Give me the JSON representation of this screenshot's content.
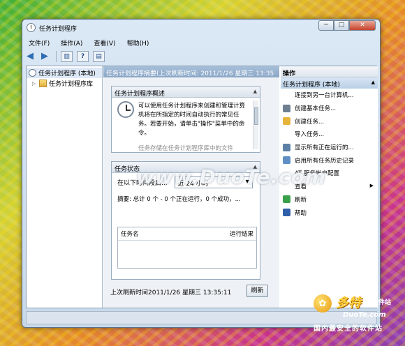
{
  "window": {
    "title": "任务计划程序",
    "min": "─",
    "max": "□",
    "close": "✕"
  },
  "menu": [
    "文件(F)",
    "操作(A)",
    "查看(V)",
    "帮助(H)"
  ],
  "toolbar": {
    "back": "◀",
    "forward": "▶",
    "help": "?"
  },
  "tree": {
    "root": "任务计划程序 (本地)",
    "child": "任务计划程序库",
    "child_expander": "▷"
  },
  "center": {
    "header": "任务计划程序摘要(上次刷新时间: 2011/1/26 星期三 13:35",
    "overview": {
      "title": "任务计划程序概述",
      "text": "可以使用任务计划程序来创建和管理计算机将在所指定的时间自动执行的常见任务。若要开始，请单击\"操作\"菜单中的命令。",
      "cut": "任务存储在任务计划程序库中的文件"
    },
    "status": {
      "title": "任务状态",
      "period_label": "在以下时间段启...",
      "period_value": "近 24 小时",
      "summary": "摘要: 总计 0 个 - 0 个正在运行，0 个成功，...",
      "col_name": "任务名",
      "col_result": "运行结果"
    },
    "footer": {
      "last_refresh": "上次刷新时间2011/1/26 星期三 13:35:11",
      "refresh_button": "刷新"
    }
  },
  "actions": {
    "title": "操作",
    "group": "任务计划程序 (本地)",
    "items": [
      {
        "label": "连接到另一台计算机...",
        "icon": "blank-icon",
        "color": "#ffffff"
      },
      {
        "label": "创建基本任务...",
        "icon": "clock-icon",
        "color": "#6d7f91"
      },
      {
        "label": "创建任务...",
        "icon": "task-icon",
        "color": "#e6b43a"
      },
      {
        "label": "导入任务...",
        "icon": "blank-icon",
        "color": "#ffffff"
      },
      {
        "label": "显示所有正在运行的...",
        "icon": "list-icon",
        "color": "#5c7fa6"
      },
      {
        "label": "启用所有任务历史记录",
        "icon": "history-icon",
        "color": "#5f8fc4"
      },
      {
        "label": "AT 服务帐户配置",
        "icon": "blank-icon",
        "color": "#ffffff"
      },
      {
        "label": "查看",
        "icon": "blank-icon",
        "color": "#ffffff",
        "more": "▶"
      },
      {
        "label": "刷新",
        "icon": "refresh-icon",
        "color": "#3aa04a"
      },
      {
        "label": "帮助",
        "icon": "help-icon",
        "color": "#2f5fa8"
      }
    ]
  },
  "watermark": {
    "site": "www.DuoTe.com",
    "logo_badge": "✿",
    "logo_cn": "多特",
    "logo_cn_small": "软件站",
    "logo_en": "DuoTe.com",
    "logo_sub": "国内最安全的软件站"
  }
}
